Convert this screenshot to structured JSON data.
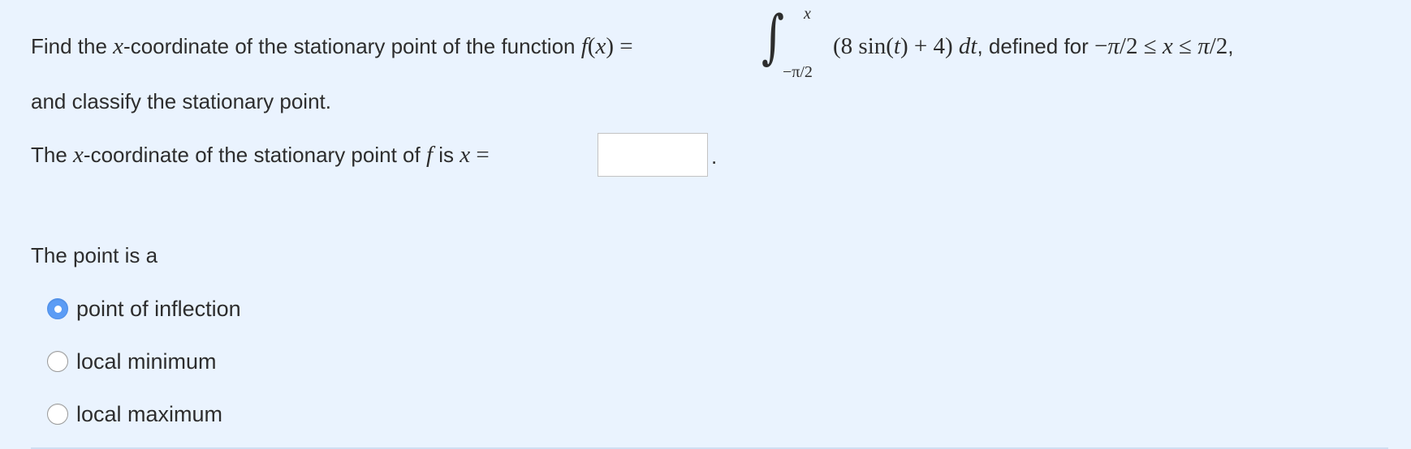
{
  "question": {
    "prompt_part1": "Find the ",
    "var_x": "x",
    "prompt_part2": "-coordinate of the stationary point of the function ",
    "function_lhs": "f(x) =",
    "integral_upper": "x",
    "integral_lower": "−π/2",
    "integrand": "(8 sin(t) + 4) dt",
    "prompt_part3": ", defined for ",
    "domain_math": "−π/2 ≤ x ≤ π/2",
    "prompt_part4": ",",
    "line2": "and classify the stationary point."
  },
  "answer_line": {
    "text_part1": "The ",
    "var_x": "x",
    "text_part2": "-coordinate of the stationary point of ",
    "var_f": "f",
    "text_part3": " is ",
    "eq": "x =",
    "input_value": "",
    "input_placeholder": "",
    "trailing": "."
  },
  "classification": {
    "label": "The point is a",
    "options": [
      {
        "label": "point of inflection",
        "selected": true
      },
      {
        "label": "local minimum",
        "selected": false
      },
      {
        "label": "local maximum",
        "selected": false
      }
    ]
  },
  "colors": {
    "background": "#eaf3fe",
    "radio_selected": "#5b9cf5",
    "text": "#2d2d2d"
  }
}
